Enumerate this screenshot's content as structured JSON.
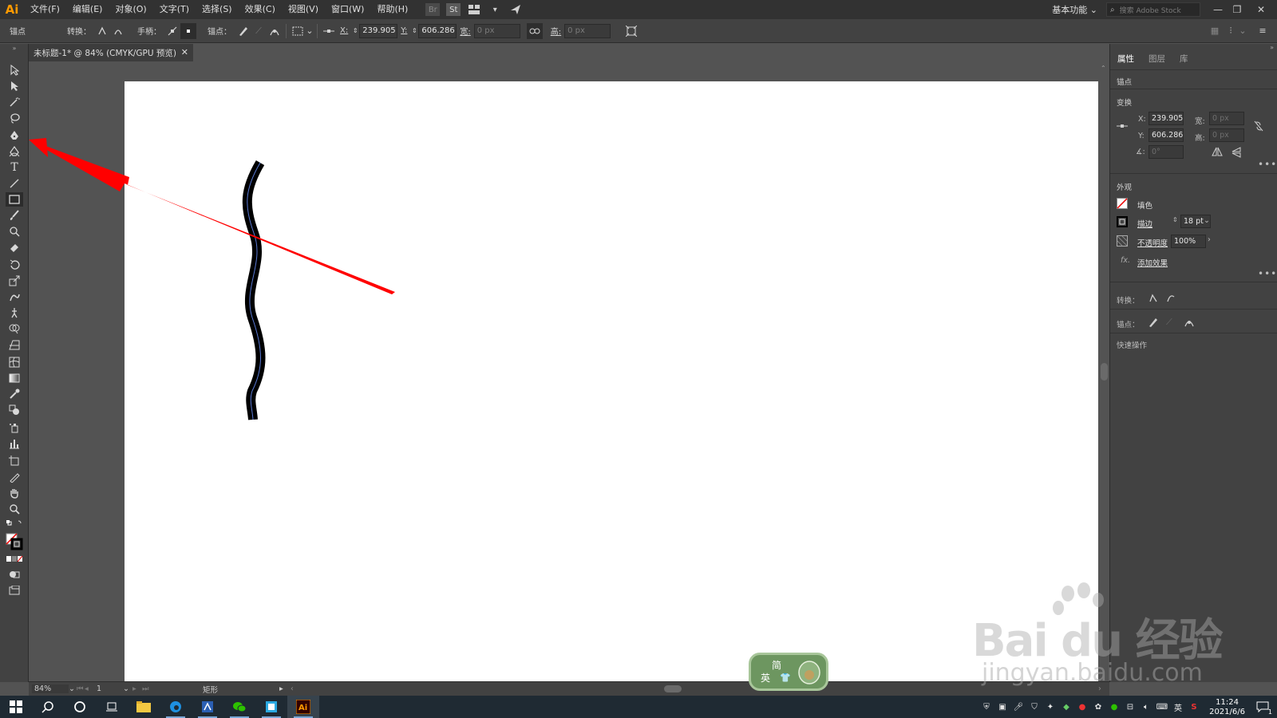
{
  "app": {
    "logo": "Ai"
  },
  "menubar": {
    "items": [
      "文件(F)",
      "编辑(E)",
      "对象(O)",
      "文字(T)",
      "选择(S)",
      "效果(C)",
      "视图(V)",
      "窗口(W)",
      "帮助(H)"
    ],
    "bridge_label": "Br",
    "stock_label": "St",
    "workspace": "基本功能",
    "search_placeholder": "搜索 Adobe Stock"
  },
  "controlbar": {
    "anchor_label": "锚点",
    "convert_label": "转换：",
    "handles_label": "手柄：",
    "anchor_points_label": "锚点：",
    "x_label": "X:",
    "x_value": "239.905",
    "y_label": "Y:",
    "y_value": "606.286",
    "w_label": "宽:",
    "w_value": "0 px",
    "h_label": "高:",
    "h_value": "0 px"
  },
  "document": {
    "tab_title": "未标题-1* @ 84% (CMYK/GPU 预览)"
  },
  "panel": {
    "tabs": [
      "属性",
      "图层",
      "库"
    ],
    "selection_label": "锚点",
    "transform": {
      "title": "变换",
      "x_label": "X:",
      "x_value": "239.905",
      "y_label": "Y:",
      "y_value": "606.286",
      "w_label": "宽:",
      "w_value": "0 px",
      "h_label": "高:",
      "h_value": "0 px",
      "angle_value": "0°"
    },
    "appearance": {
      "title": "外观",
      "fill_label": "填色",
      "stroke_label": "描边",
      "stroke_value": "18 pt",
      "opacity_label": "不透明度",
      "opacity_value": "100%",
      "effects_label": "添加效果",
      "fx": "fx."
    },
    "convert_label": "转换：",
    "anchor_label": "锚点：",
    "quick_actions_label": "快速操作"
  },
  "statusbar": {
    "zoom": "84%",
    "artboard_number": "1",
    "tool_name": "矩形"
  },
  "ime": {
    "line1": "简",
    "line2": "英"
  },
  "watermark": {
    "brand": "Bai  du 经验",
    "url": "jingyan.baidu.com"
  },
  "taskbar": {
    "time": "11:24",
    "date": "2021/6/6",
    "ime_lang": "英",
    "notification_count": "1"
  },
  "colors": {
    "accent_orange": "#ff9a00",
    "annotation_red": "#ff0000",
    "wave_stroke": "#000000",
    "path_blue": "#5a7ad6"
  },
  "icons": [
    "selection-icon",
    "direct-selection-icon",
    "magic-wand-icon",
    "lasso-icon",
    "pen-icon",
    "curvature-icon",
    "type-icon",
    "line-icon",
    "rectangle-icon",
    "paintbrush-icon",
    "shaper-icon",
    "eraser-icon",
    "rotate-icon",
    "scale-icon",
    "warp-icon",
    "puppet-warp-icon",
    "shape-builder-icon",
    "perspective-icon",
    "mesh-icon",
    "gradient-icon",
    "eyedropper-icon",
    "blend-icon",
    "symbol-sprayer-icon",
    "graph-icon",
    "artboard-icon",
    "slice-icon",
    "hand-icon",
    "zoom-icon"
  ]
}
